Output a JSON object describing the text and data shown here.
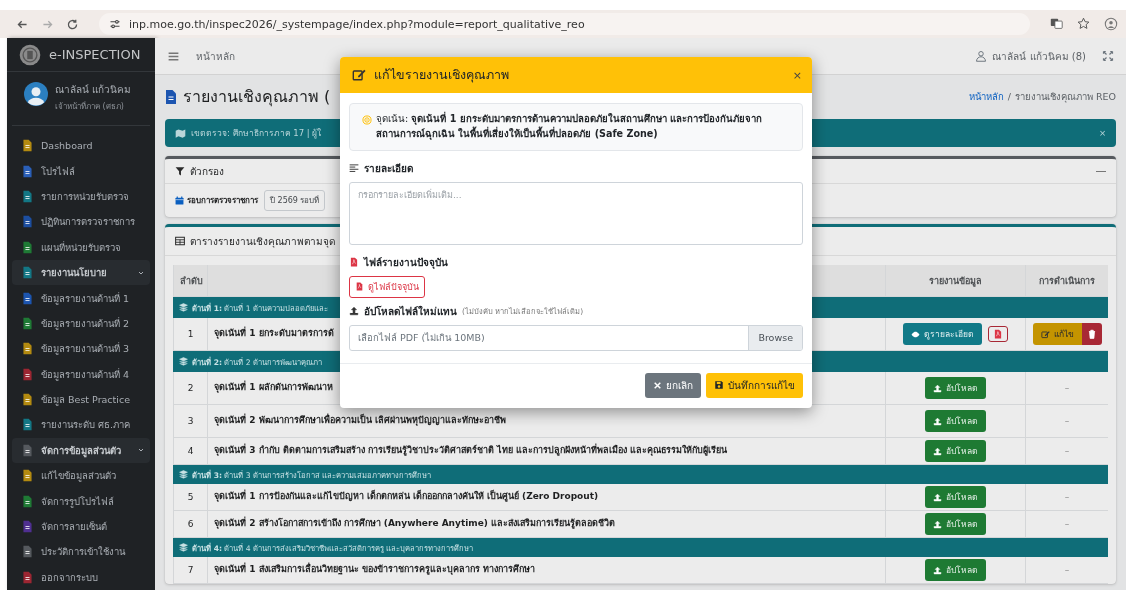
{
  "browser": {
    "url": "inp.moe.go.th/inspec2026/_systempage/index.php?module=report_qualitative_reo"
  },
  "sidebar": {
    "brand": "e-INSPECTION",
    "user": {
      "name": "ณาลัลน์ แก้วนิคม",
      "role": "เจ้าหน้าที่ภาค (ศธภ)"
    },
    "items": [
      {
        "label": "Dashboard",
        "color": "#b38a10"
      },
      {
        "label": "โปรไฟล์",
        "color": "#2a5fb8"
      },
      {
        "label": "รายการหน่วยรับตรวจ",
        "color": "#137785"
      },
      {
        "label": "ปฏิทินการตรวจราชการ",
        "color": "#1c4ea0"
      },
      {
        "label": "แผนที่หน่วยรับตรวจ",
        "color": "#1f7a35"
      },
      {
        "label": "รายงานนโยบาย",
        "color": "#137785",
        "expanded": true,
        "children": [
          {
            "label": "ข้อมูลรายงานด้านที่ 1",
            "color": "#1c55b0"
          },
          {
            "label": "ข้อมูลรายงานด้านที่ 2",
            "color": "#1f7a35"
          },
          {
            "label": "ข้อมูลรายงานด้านที่ 3",
            "color": "#b38a10"
          },
          {
            "label": "ข้อมูลรายงานด้านที่ 4",
            "color": "#9c2632"
          },
          {
            "label": "ข้อมูล Best Practice",
            "color": "#b38a10"
          },
          {
            "label": "รายงานระดับ ศธ.ภาค",
            "color": "#137785"
          }
        ]
      },
      {
        "label": "จัดการข้อมูลส่วนตัว",
        "color": "#55595e",
        "expanded": true,
        "children": [
          {
            "label": "แก้ไขข้อมูลส่วนตัว",
            "color": "#b38a10"
          },
          {
            "label": "จัดการรูปโปรไฟล์",
            "color": "#1f7a35"
          },
          {
            "label": "จัดการลายเซ็นต์",
            "color": "#4f2f91"
          },
          {
            "label": "ประวัติการเข้าใช้งาน",
            "color": "#55595e"
          },
          {
            "label": "ออกจากระบบ",
            "color": "#9c2632"
          }
        ]
      }
    ]
  },
  "navbar": {
    "home": "หน้าหลัก",
    "user": "ณาลัลน์ แก้วนิคม (8)"
  },
  "page": {
    "title": "รายงานเชิงคุณภาพ (",
    "breadcrumb": {
      "items": [
        "หน้าหลัก",
        "รายงานเชิงคุณภาพ REO"
      ],
      "separator": "/"
    }
  },
  "banner": {
    "text": "เขตตรวจ: ศึกษาธิการภาค 17  |  ผู้ใ",
    "close": "×"
  },
  "filter": {
    "title": "ตัวกรอง",
    "label": "รอบการตรวจราชการ",
    "value": "ปี 2569 รอบที่"
  },
  "table": {
    "title": "ตารางรายงานเชิงคุณภาพตามจุด",
    "columns": [
      "ลำดับ",
      "รายงานข้อมูล",
      "การดำเนินการ"
    ],
    "rows": [
      {
        "kind": "group",
        "text": "**ด้านที่ 1:** ด้านที่ 1 ด้านความปลอดภัยและ"
      },
      {
        "kind": "item",
        "no": "1",
        "text": "จุดเน้นที่ 1 ยกระดับมาตรการด้",
        "report": [
          {
            "kind": "view",
            "label": "ดูรายละเอียด"
          },
          {
            "kind": "pdf"
          }
        ],
        "actions": [
          {
            "kind": "edit",
            "label": "แก้ไข"
          },
          {
            "kind": "delete"
          }
        ]
      },
      {
        "kind": "group",
        "text": "**ด้านที่ 2:** ด้านที่ 2 ด้านการพัฒนาคุณภา"
      },
      {
        "kind": "item",
        "no": "2",
        "text": "จุดเน้นที่ 1 ผลักดันการพัฒนาห",
        "report": [
          {
            "kind": "upload",
            "label": "อัปโหลด"
          }
        ],
        "action_text": "–"
      },
      {
        "kind": "item",
        "no": "3",
        "text": "จุดเน้นที่ 2 พัฒนาการศึกษาเพื่อความเป็น เลิศผ่านพหุปัญญาและทักษะอาชีพ",
        "report": [
          {
            "kind": "upload",
            "label": "อัปโหลด"
          }
        ],
        "action_text": "–"
      },
      {
        "kind": "item",
        "no": "4",
        "text": "จุดเน้นที่ 3 กำกับ ติดตามการเสริมสร้าง การเรียนรู้วิชาประวัติศาสตร์ชาติ ไทย และการปลูกฝังหน้าที่พลเมือง และคุณธรรมให้กับผู้เรียน",
        "report": [
          {
            "kind": "upload",
            "label": "อัปโหลด"
          }
        ],
        "action_text": "–"
      },
      {
        "kind": "group",
        "text": "**ด้านที่ 3:** ด้านที่ 3 ด้านการสร้างโอกาส และความเสมอภาคทางการศึกษา"
      },
      {
        "kind": "item",
        "no": "5",
        "text": "จุดเน้นที่ 1 การป้องกันและแก้ไขปัญหา เด็กตกหล่น เด็กออกกลางคันให้ เป็นศูนย์ (Zero Dropout)",
        "report": [
          {
            "kind": "upload",
            "label": "อัปโหลด"
          }
        ],
        "action_text": "–"
      },
      {
        "kind": "item",
        "no": "6",
        "text": "จุดเน้นที่ 2 สร้างโอกาสการเข้าถึง การศึกษา (Anywhere Anytime) และส่งเสริมการเรียนรู้ตลอดชีวิต",
        "report": [
          {
            "kind": "upload",
            "label": "อัปโหลด"
          }
        ],
        "action_text": "–"
      },
      {
        "kind": "group",
        "text": "**ด้านที่ 4:** ด้านที่ 4 ด้านการส่งเสริมวิชาชีพและสวัสดิการครู และบุคลากรทางการศึกษา"
      },
      {
        "kind": "item",
        "no": "7",
        "text": "จุดเน้นที่ 1 ส่งเสริมการเลื่อนวิทยฐานะ ของข้าราชการครูและบุคลากร ทางการศึกษา",
        "report": [
          {
            "kind": "upload",
            "label": "อัปโหลด"
          }
        ],
        "action_text": "–"
      }
    ]
  },
  "modal": {
    "title": "แก้ไขรายงานเชิงคุณภาพ",
    "close": "×",
    "focus": "จุดเน้น: **จุดเน้นที่ 1 ยกระดับมาตรการด้านความปลอดภัยในสถานศึกษา และการป้องกันภัยจากสถานการณ์ฉุกเฉิน ในพื้นที่เสี่ยงให้เป็นพื้นที่ปลอดภัย (Safe Zone)**",
    "detail": {
      "label": "รายละเอียด",
      "placeholder": "กรอกรายละเอียดเพิ่มเติม..."
    },
    "current_file": {
      "label": "ไฟล์รายงานปัจจุบัน",
      "button": "ดูไฟล์ปัจจุบัน"
    },
    "upload": {
      "label": "อัปโหลดไฟล์ใหม่แทน",
      "hint": "(ไม่บังคับ หากไม่เลือกจะใช้ไฟล์เดิม)",
      "placeholder": "เลือกไฟล์ PDF (ไม่เกิน 10MB)",
      "browse": "Browse"
    },
    "buttons": [
      {
        "kind": "cancel",
        "label": "ยกเลิก"
      },
      {
        "kind": "save",
        "label": "บันทึกการแก้ไข"
      }
    ]
  }
}
